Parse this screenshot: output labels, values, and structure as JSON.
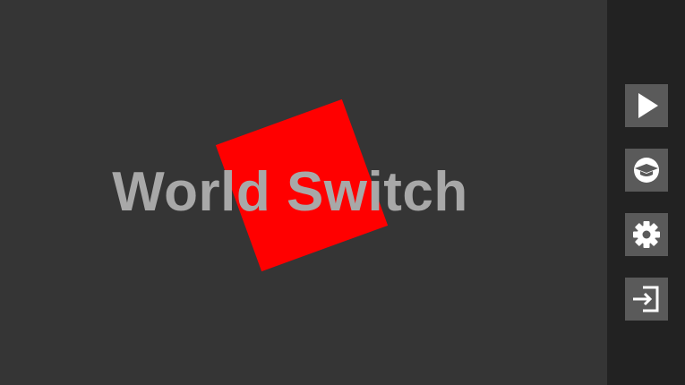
{
  "game": {
    "title": "World Switch"
  },
  "sidebar": {
    "buttons": [
      {
        "icon": "play-icon"
      },
      {
        "icon": "graduation-cap-icon"
      },
      {
        "icon": "gear-icon"
      },
      {
        "icon": "exit-icon"
      }
    ]
  },
  "colors": {
    "background": "#353535",
    "sidebar": "#222222",
    "button": "#5a5a5a",
    "icon": "#ffffff",
    "square": "#ff0000",
    "title": "#a8a8a8"
  }
}
